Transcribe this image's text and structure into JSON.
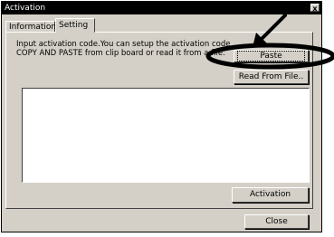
{
  "window": {
    "title": "Activation",
    "close_glyph": "x"
  },
  "tabs": [
    {
      "label": "Information",
      "active": false
    },
    {
      "label": "Setting",
      "active": true
    }
  ],
  "setting": {
    "description": "Input activation code.You can setup the activation code COPY AND PASTE from clip board or read it from a file.",
    "paste_label": "Paste",
    "read_file_label": "Read From File..",
    "activation_code_value": "",
    "activation_label": "Activation"
  },
  "footer": {
    "close_label": "Close"
  },
  "annotation": {
    "color": "#000000",
    "icons": [
      "arrow-icon",
      "highlight-ellipse"
    ]
  }
}
